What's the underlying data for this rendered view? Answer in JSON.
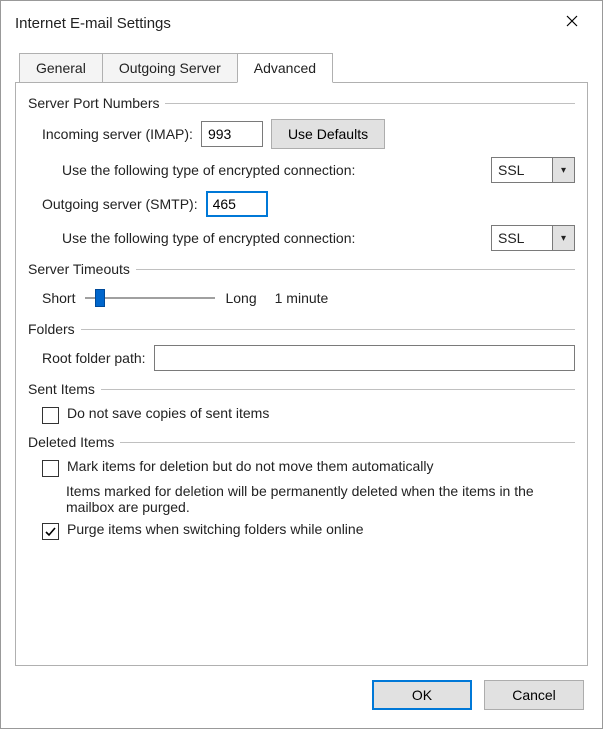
{
  "window": {
    "title": "Internet E-mail Settings"
  },
  "tabs": {
    "general": "General",
    "outgoing": "Outgoing Server",
    "advanced": "Advanced"
  },
  "groups": {
    "server_ports": "Server Port Numbers",
    "server_timeouts": "Server Timeouts",
    "folders": "Folders",
    "sent_items": "Sent Items",
    "deleted_items": "Deleted Items"
  },
  "labels": {
    "incoming_imap": "Incoming server (IMAP):",
    "use_defaults": "Use Defaults",
    "enc_type_prompt": "Use the following type of encrypted connection:",
    "outgoing_smtp": "Outgoing server (SMTP):",
    "short": "Short",
    "long": "Long",
    "root_folder": "Root folder path:",
    "do_not_save_sent": "Do not save copies of sent items",
    "mark_delete": "Mark items for deletion but do not move them automatically",
    "mark_delete_help": "Items marked for deletion will be permanently deleted when the items in the mailbox are purged.",
    "purge_switch": "Purge items when switching folders while online",
    "ok": "OK",
    "cancel": "Cancel"
  },
  "values": {
    "imap_port": "993",
    "smtp_port": "465",
    "imap_encryption": "SSL",
    "smtp_encryption": "SSL",
    "timeout_display": "1 minute",
    "root_folder_path": ""
  },
  "checks": {
    "do_not_save_sent": false,
    "mark_delete": false,
    "purge_switch": true
  }
}
